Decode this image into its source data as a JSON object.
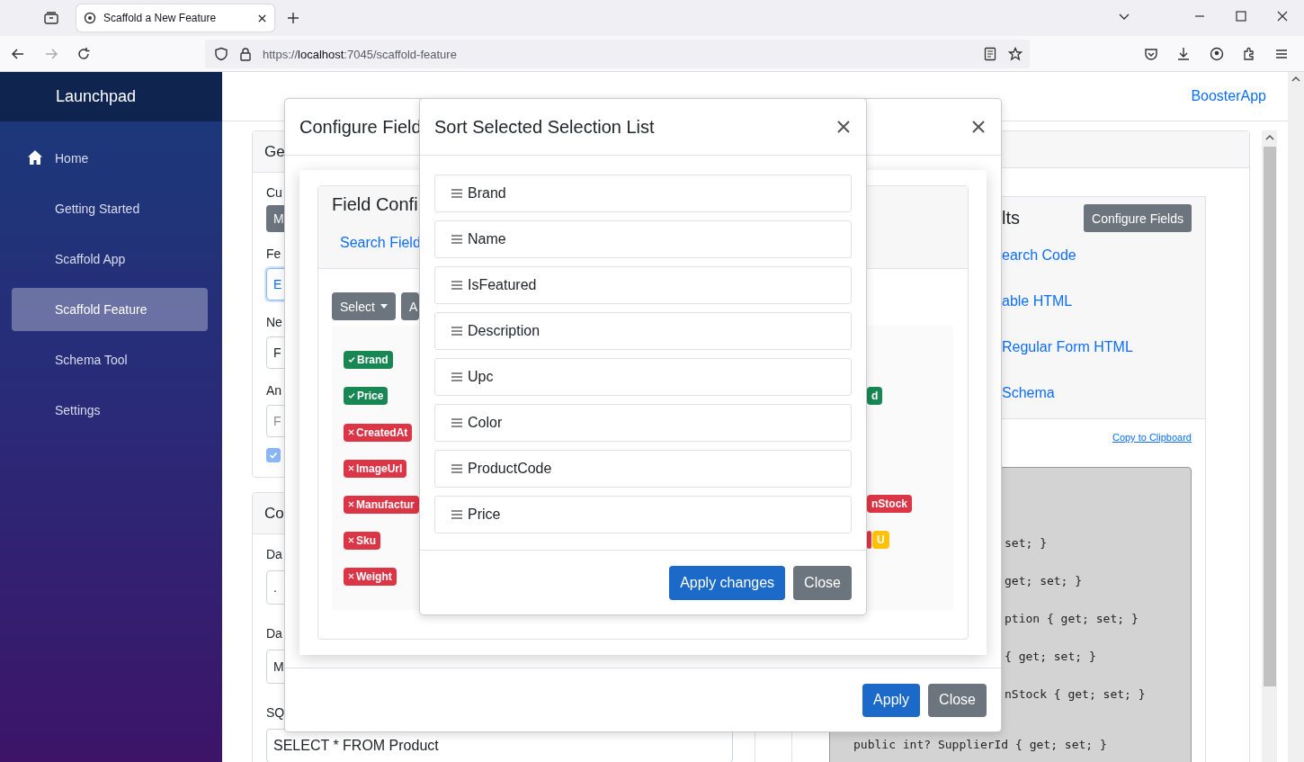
{
  "browser": {
    "tab_title": "Scaffold a New Feature",
    "url_scheme": "https://",
    "url_host": "localhost",
    "url_path": ":7045/scaffold-feature"
  },
  "sidebar": {
    "brand": "Launchpad",
    "items": [
      {
        "label": "Home",
        "selected": false
      },
      {
        "label": "Getting Started",
        "selected": false
      },
      {
        "label": "Scaffold App",
        "selected": false
      },
      {
        "label": "Scaffold Feature",
        "selected": true
      },
      {
        "label": "Schema Tool",
        "selected": false
      },
      {
        "label": "Settings",
        "selected": false
      }
    ]
  },
  "header": {
    "app_link": "BoosterApp"
  },
  "general_card": {
    "title": "Ge",
    "rows": [
      {
        "kind": "label",
        "text": "Cu"
      },
      {
        "kind": "button",
        "text": "M"
      },
      {
        "kind": "label",
        "text": "Fe"
      },
      {
        "kind": "input",
        "value": "E",
        "focused": true
      },
      {
        "kind": "label",
        "text": "Ne"
      },
      {
        "kind": "input",
        "value": "F",
        "focused": false
      },
      {
        "kind": "label",
        "text": "An"
      },
      {
        "kind": "input",
        "placeholder": "F",
        "focused": false
      },
      {
        "kind": "checkbox",
        "checked": true
      }
    ]
  },
  "code_card": {
    "title": "Co",
    "rows": [
      {
        "kind": "label",
        "text": "Da"
      },
      {
        "kind": "input",
        "value": ".",
        "focused": false
      },
      {
        "kind": "label",
        "text": "Da"
      },
      {
        "kind": "input",
        "value": "M",
        "focused": false
      },
      {
        "kind": "label",
        "text": "SQ"
      },
      {
        "kind": "input",
        "value": "SELECT * FROM Product",
        "focused": false
      }
    ]
  },
  "results_card": {
    "title": "lts",
    "configure_button": "Configure Fields",
    "links": [
      "earch Code",
      "able HTML",
      "Regular Form HTML",
      "Schema"
    ],
    "copy_link": "Copy to Clipboard",
    "code_lines": [
      "set; }",
      "get; set; }",
      "ption { get; set; }",
      "{ get; set; }",
      "nStock { get; set; }",
      "public int? SupplierId { get; set; }"
    ]
  },
  "configure_modal": {
    "title": "Configure Field",
    "card_title": "Field Confi",
    "tab_link": "Search Field",
    "select_button": "Select",
    "second_button": "A",
    "tag_rows": [
      {
        "left": {
          "text": "Brand",
          "kind": "included",
          "color": "#198754"
        }
      },
      {
        "left": {
          "text": "Price",
          "kind": "included",
          "color": "#198754"
        },
        "right": [
          {
            "text": "d",
            "color": "#198754"
          }
        ]
      },
      {
        "left": {
          "text": "CreatedAt",
          "kind": "excluded",
          "color": "#dc3545"
        }
      },
      {
        "left": {
          "text": "ImageUrl",
          "kind": "excluded",
          "color": "#dc3545"
        }
      },
      {
        "left": {
          "text": "Manufactur",
          "kind": "excluded",
          "color": "#dc3545"
        },
        "right": [
          {
            "text": "nStock",
            "color": "#dc3545"
          }
        ]
      },
      {
        "left": {
          "text": "Sku",
          "kind": "excluded",
          "color": "#dc3545"
        },
        "right": [
          {
            "color": "#dc3545"
          },
          {
            "text": "U",
            "color": "#ffc107"
          }
        ]
      },
      {
        "left": {
          "text": "Weight",
          "kind": "excluded",
          "color": "#dc3545"
        }
      }
    ],
    "apply_button": "Apply",
    "close_button": "Close"
  },
  "sort_modal": {
    "title": "Sort Selected Selection List",
    "items": [
      "Brand",
      "Name",
      "IsFeatured",
      "Description",
      "Upc",
      "Color",
      "ProductCode",
      "Price"
    ],
    "apply_button": "Apply changes",
    "close_button": "Close"
  }
}
